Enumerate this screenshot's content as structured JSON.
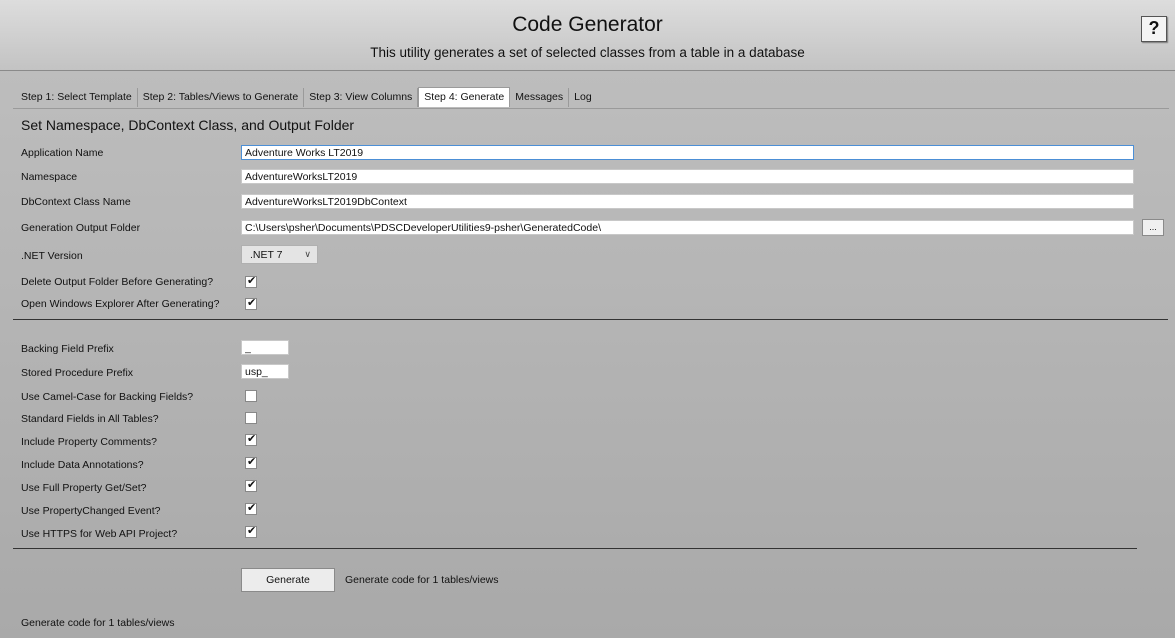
{
  "header": {
    "title": "Code Generator",
    "subtitle": "This utility generates a set of selected classes from a table in a database",
    "help_label": "?"
  },
  "tabs": [
    {
      "label": "Step 1: Select Template",
      "active": false
    },
    {
      "label": "Step 2: Tables/Views to Generate",
      "active": false
    },
    {
      "label": "Step 3: View Columns",
      "active": false
    },
    {
      "label": "Step 4: Generate",
      "active": true
    },
    {
      "label": "Messages",
      "active": false
    },
    {
      "label": "Log",
      "active": false
    }
  ],
  "section_title": "Set Namespace, DbContext Class, and Output Folder",
  "fields": {
    "app_name": {
      "label": "Application Name",
      "value": "Adventure Works LT2019"
    },
    "namespace": {
      "label": "Namespace",
      "value": "AdventureWorksLT2019"
    },
    "dbcontext": {
      "label": "DbContext Class Name",
      "value": "AdventureWorksLT2019DbContext"
    },
    "output_folder": {
      "label": "Generation Output Folder",
      "value": "C:\\Users\\psher\\Documents\\PDSCDeveloperUtilities9-psher\\GeneratedCode\\"
    },
    "browse_label": "...",
    "net_version": {
      "label": ".NET Version",
      "selected": ".NET 7"
    },
    "delete_output": {
      "label": "Delete Output Folder Before Generating?",
      "checked": true
    },
    "open_explorer": {
      "label": "Open Windows Explorer After Generating?",
      "checked": true
    }
  },
  "options": {
    "backing_prefix": {
      "label": "Backing Field Prefix",
      "value": "_"
    },
    "sp_prefix": {
      "label": "Stored Procedure Prefix",
      "value": "usp_"
    },
    "camel_case": {
      "label": "Use Camel-Case for Backing Fields?",
      "checked": false
    },
    "standard_fields": {
      "label": "Standard Fields in All Tables?",
      "checked": false
    },
    "property_comments": {
      "label": "Include Property Comments?",
      "checked": true
    },
    "data_annotations": {
      "label": "Include Data Annotations?",
      "checked": true
    },
    "full_property": {
      "label": "Use Full Property Get/Set?",
      "checked": true
    },
    "property_changed": {
      "label": "Use PropertyChanged Event?",
      "checked": true
    },
    "https": {
      "label": "Use HTTPS for Web API Project?",
      "checked": true
    }
  },
  "generate": {
    "button_label": "Generate",
    "message": "Generate code for 1 tables/views"
  },
  "status_bar": "Generate code for 1 tables/views"
}
